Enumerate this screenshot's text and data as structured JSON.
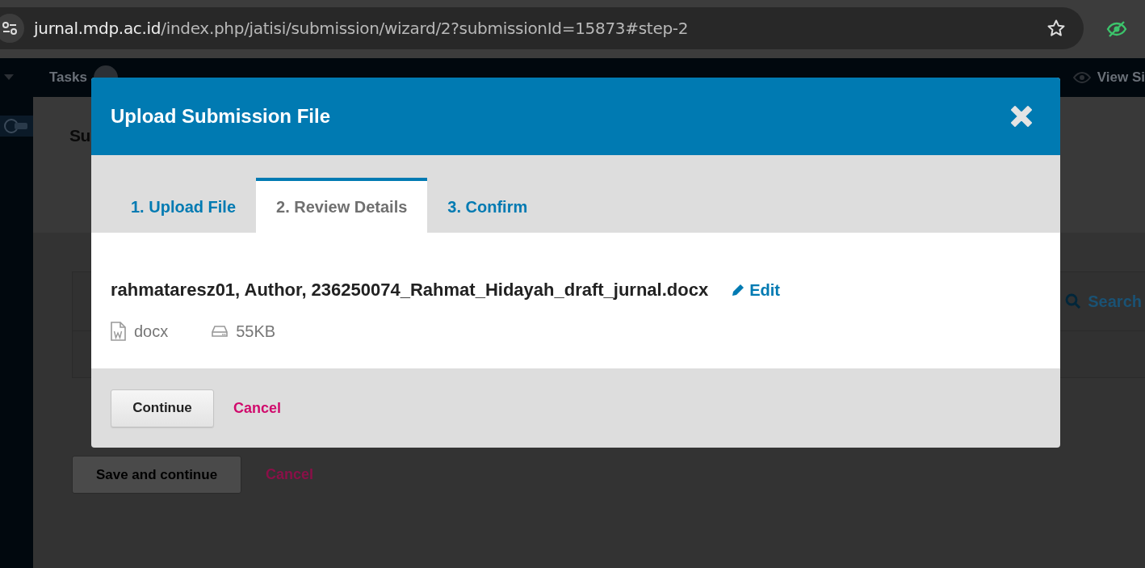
{
  "browser": {
    "url_host": "jurnal.mdp.ac.id",
    "url_path": "/index.php/jatisi/submission/wizard/2?submissionId=15873#step-2"
  },
  "nav": {
    "tasks_label": "Tasks",
    "view_site": "View Si"
  },
  "page": {
    "heading": "Su",
    "search": "Search",
    "save_button": "Save and continue",
    "cancel": "Cancel"
  },
  "modal": {
    "title": "Upload Submission File",
    "tabs": [
      {
        "label": "1. Upload File",
        "selected": false
      },
      {
        "label": "2. Review Details",
        "selected": true
      },
      {
        "label": "3. Confirm",
        "selected": false
      }
    ],
    "file_title": "rahmataresz01, Author, 236250074_Rahmat_Hidayah_draft_jurnal.docx",
    "edit": "Edit",
    "file_type": "docx",
    "file_size": "55KB",
    "continue": "Continue",
    "cancel": "Cancel"
  }
}
